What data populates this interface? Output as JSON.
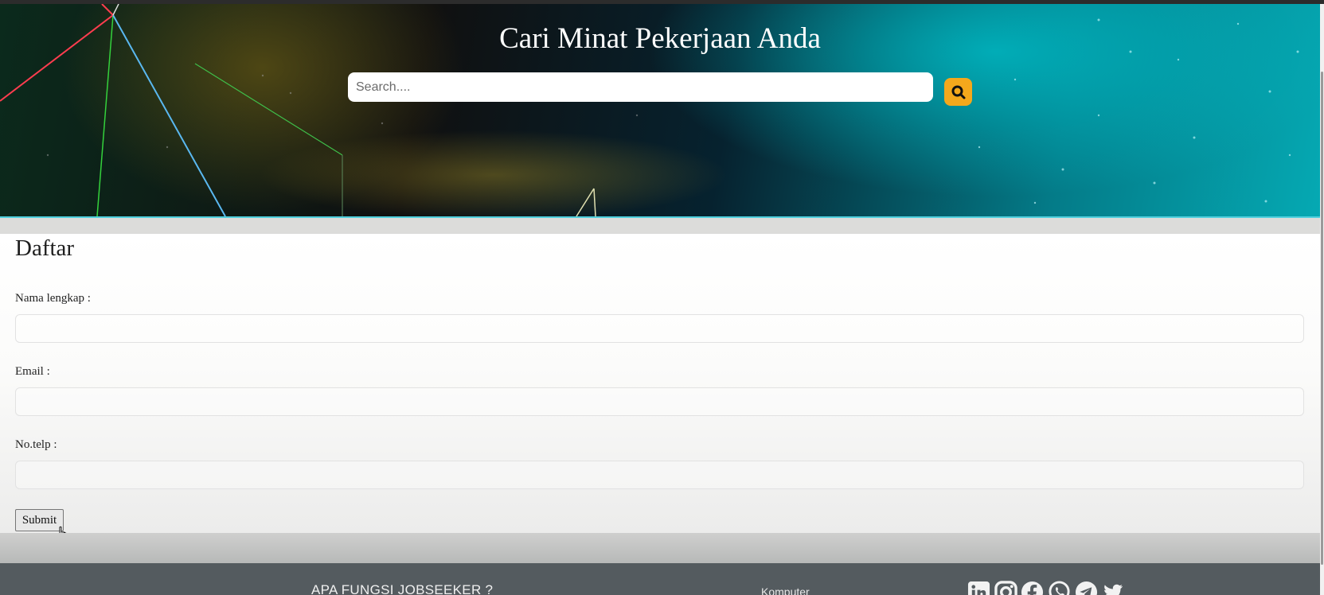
{
  "hero": {
    "title": "Cari Minat Pekerjaan Anda",
    "search_placeholder": "Search....",
    "search_icon": "search-icon",
    "accent_color": "#f4a81c"
  },
  "form": {
    "title": "Daftar",
    "fields": [
      {
        "label": "Nama lengkap :",
        "value": ""
      },
      {
        "label": "Email :",
        "value": ""
      },
      {
        "label": "No.telp :",
        "value": ""
      }
    ],
    "submit_label": "Submit"
  },
  "footer": {
    "heading": "APA FUNGSI JOBSEEKER ?",
    "link": "Komputer",
    "social_icons": [
      "linkedin-icon",
      "instagram-icon",
      "facebook-icon",
      "whatsapp-icon",
      "telegram-icon",
      "twitter-icon"
    ]
  }
}
